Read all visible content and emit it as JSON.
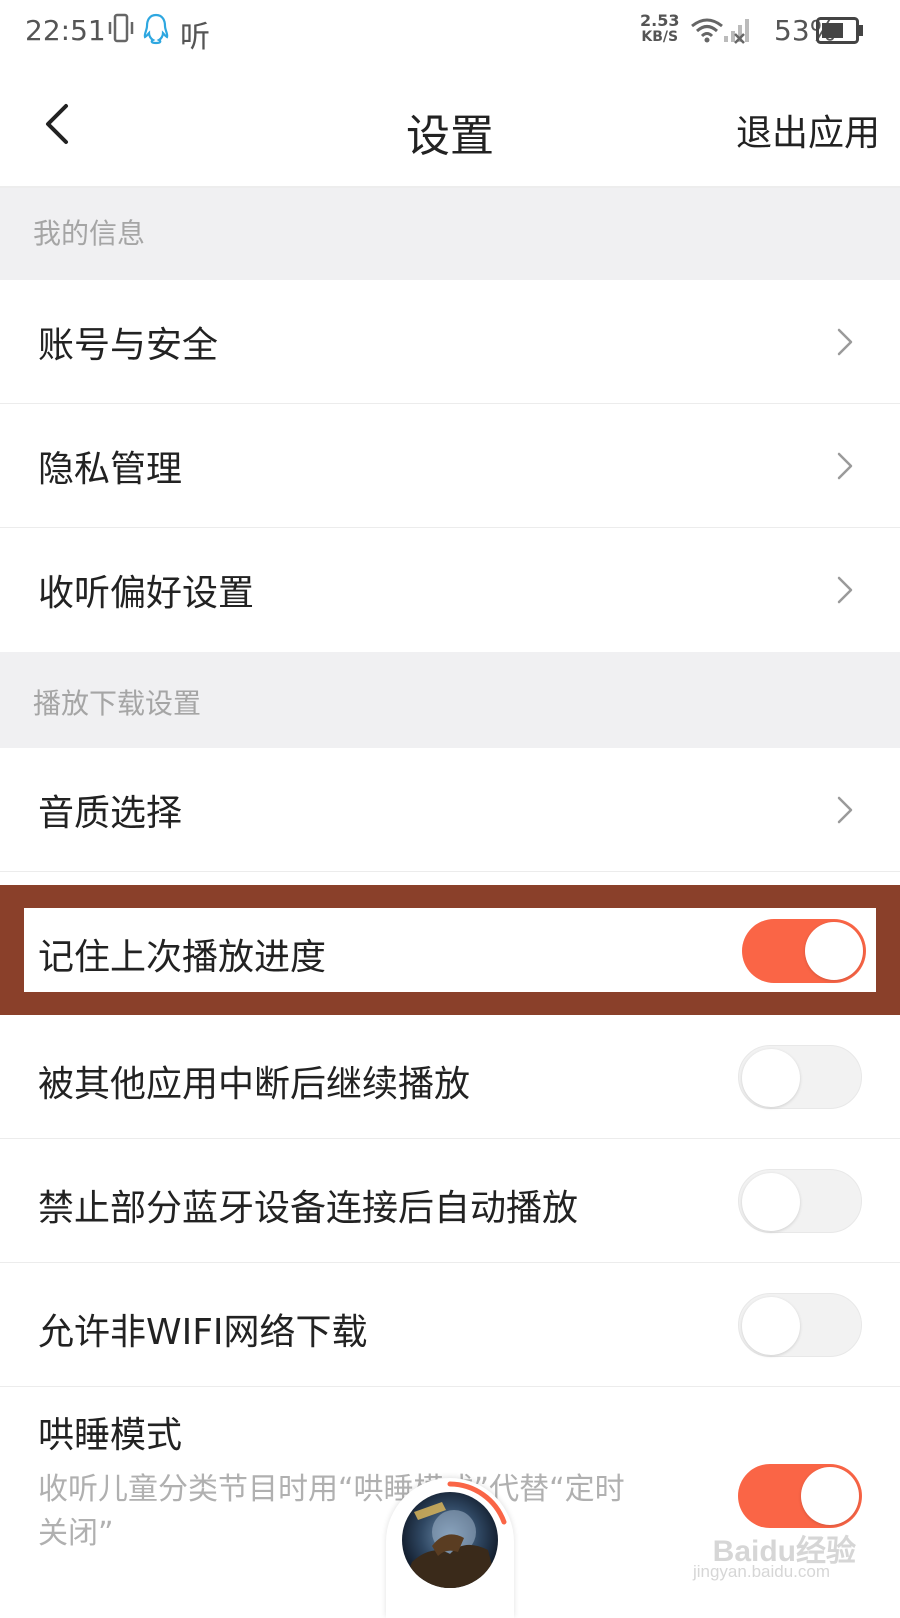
{
  "status_bar": {
    "time": "22:51",
    "listen_app_label": "听",
    "net_speed_value": "2.53",
    "net_speed_unit": "KB/S",
    "battery": "53%",
    "icons": [
      "vibrate-icon",
      "qq-icon",
      "wifi-icon",
      "signal-none-icon",
      "battery-icon"
    ]
  },
  "header": {
    "title": "设置",
    "exit_label": "退出应用",
    "back_icon": "chevron-left-icon"
  },
  "sections": {
    "my_info": {
      "title": "我的信息",
      "items": [
        {
          "label": "账号与安全"
        },
        {
          "label": "隐私管理"
        },
        {
          "label": "收听偏好设置"
        }
      ]
    },
    "playback": {
      "title": "播放下载设置",
      "quality": {
        "label": "音质选择"
      },
      "remember_progress": {
        "label": "记住上次播放进度",
        "enabled": true
      },
      "resume_after_interrupt": {
        "label": "被其他应用中断后继续播放",
        "enabled": false
      },
      "block_bluetooth_autoplay": {
        "label": "禁止部分蓝牙设备连接后自动播放",
        "enabled": false
      },
      "allow_non_wifi_download": {
        "label": "允许非WIFI网络下载",
        "enabled": false
      },
      "lullaby_mode": {
        "label": "哄睡模式",
        "description": "收听儿童分类节目时用“哄睡模式”代替“定时关闭”",
        "enabled": true
      }
    }
  },
  "colors": {
    "accent": "#fa6546",
    "section_bg": "#f0f0f2",
    "highlight_frame": "#8a402a"
  },
  "watermark": {
    "brand": "Baidu经验",
    "url": "jingyan.baidu.com"
  }
}
